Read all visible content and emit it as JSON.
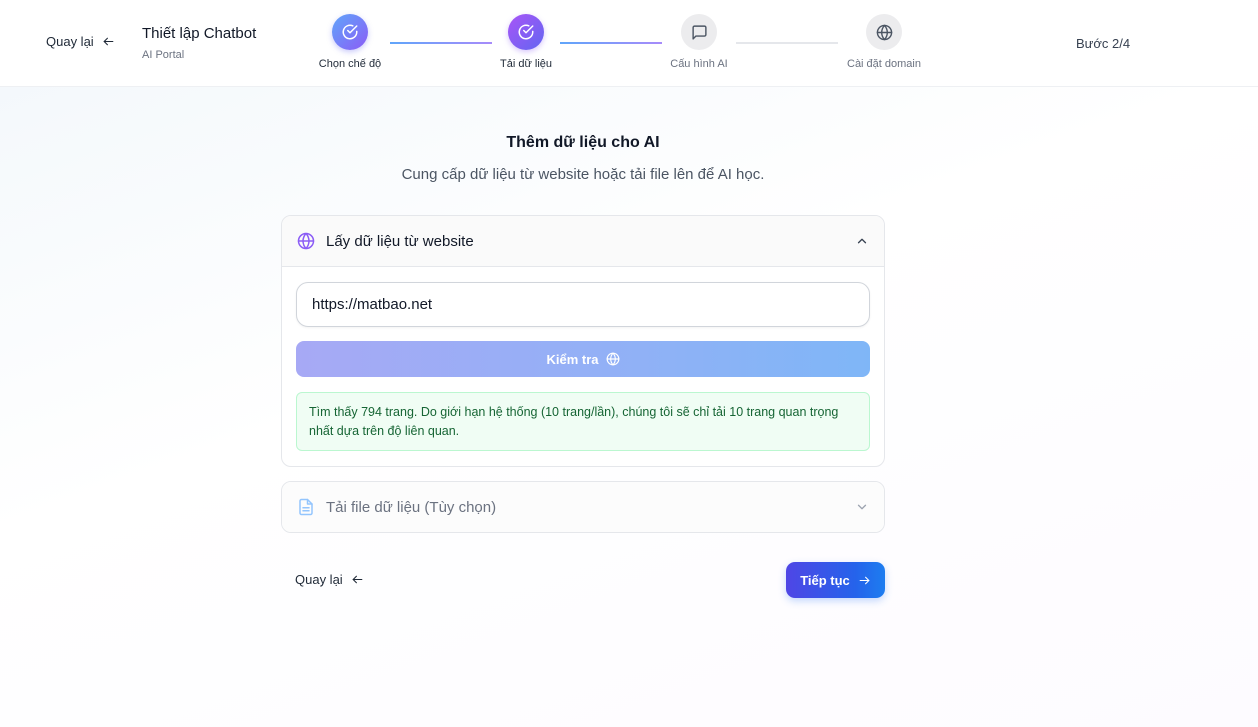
{
  "header": {
    "back_label": "Quay lại",
    "title": "Thiết lập Chatbot",
    "subtitle": "AI Portal",
    "step_count": "Bước 2/4",
    "steps": [
      {
        "label": "Chọn chế độ",
        "state": "done",
        "icon": "check-circle-icon"
      },
      {
        "label": "Tải dữ liệu",
        "state": "current",
        "icon": "check-circle-icon"
      },
      {
        "label": "Cấu hình AI",
        "state": "pending",
        "icon": "message-square-icon"
      },
      {
        "label": "Cài đặt domain",
        "state": "pending",
        "icon": "globe-icon"
      }
    ]
  },
  "main": {
    "title": "Thêm dữ liệu cho AI",
    "subtitle": "Cung cấp dữ liệu từ website hoặc tải file lên để AI học.",
    "website_section": {
      "title": "Lấy dữ liệu từ website",
      "icon": "globe-icon",
      "expanded": true,
      "url_value": "https://matbao.net",
      "check_button_label": "Kiểm tra",
      "notice": "Tìm thấy 794 trang. Do giới hạn hệ thống (10 trang/lần), chúng tôi sẽ chỉ tải 10 trang quan trọng nhất dựa trên độ liên quan."
    },
    "upload_section": {
      "title": "Tải file dữ liệu (Tùy chọn)",
      "icon": "file-text-icon",
      "expanded": false
    }
  },
  "footer": {
    "back_label": "Quay lại",
    "continue_label": "Tiếp tục"
  },
  "colors": {
    "accent": "#6366f1",
    "primary_button": "#2563eb",
    "success_bg": "#f0fdf4",
    "success_text": "#166534"
  }
}
